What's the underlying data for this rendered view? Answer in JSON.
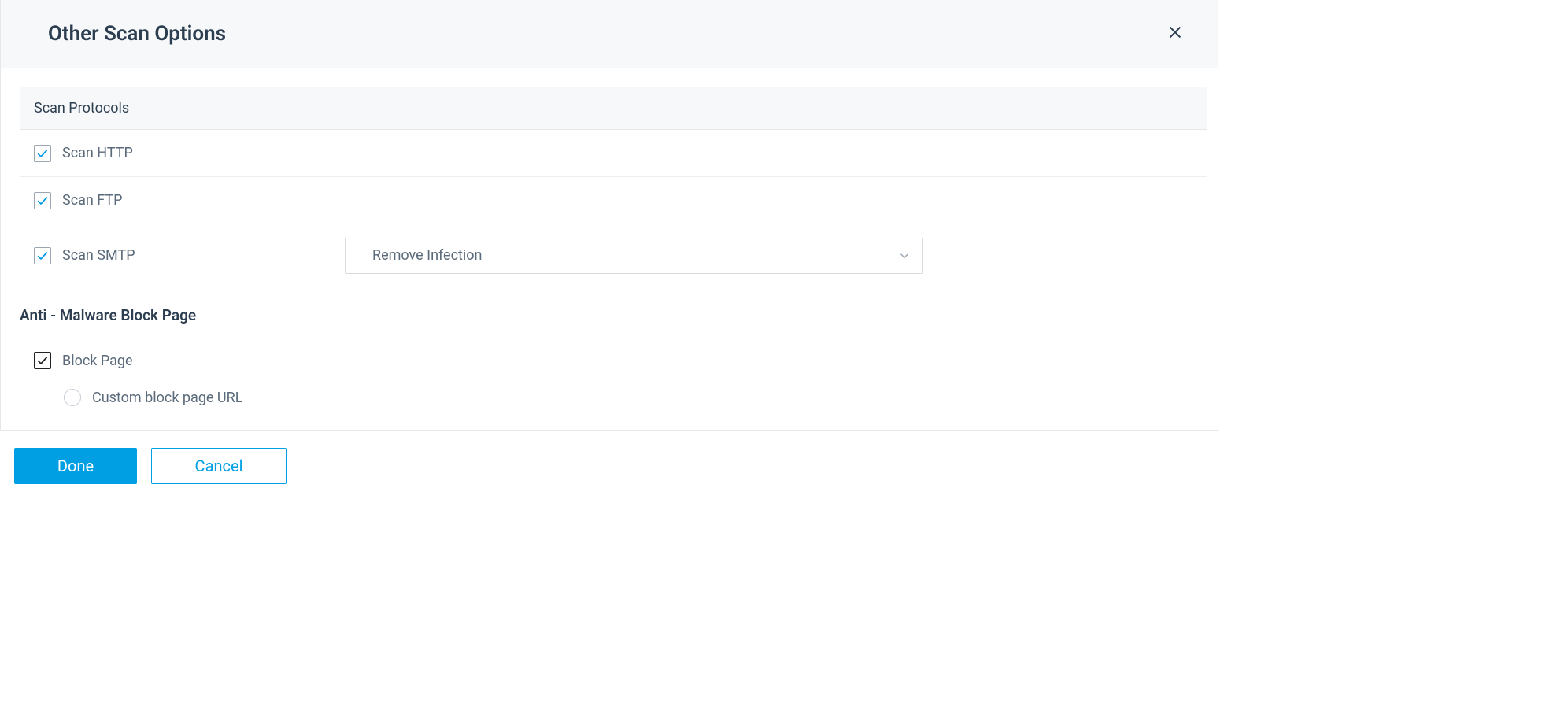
{
  "header": {
    "title": "Other Scan Options"
  },
  "scanProtocols": {
    "title": "Scan Protocols",
    "items": {
      "http": {
        "label": "Scan HTTP",
        "checked": true
      },
      "ftp": {
        "label": "Scan FTP",
        "checked": true
      },
      "smtp": {
        "label": "Scan SMTP",
        "checked": true,
        "actionSelected": "Remove Infection"
      }
    }
  },
  "antiMalware": {
    "title": "Anti - Malware Block Page",
    "blockPage": {
      "label": "Block Page",
      "checked": true
    },
    "customUrl": {
      "label": "Custom block page URL",
      "selected": false
    }
  },
  "footer": {
    "done": "Done",
    "cancel": "Cancel"
  }
}
